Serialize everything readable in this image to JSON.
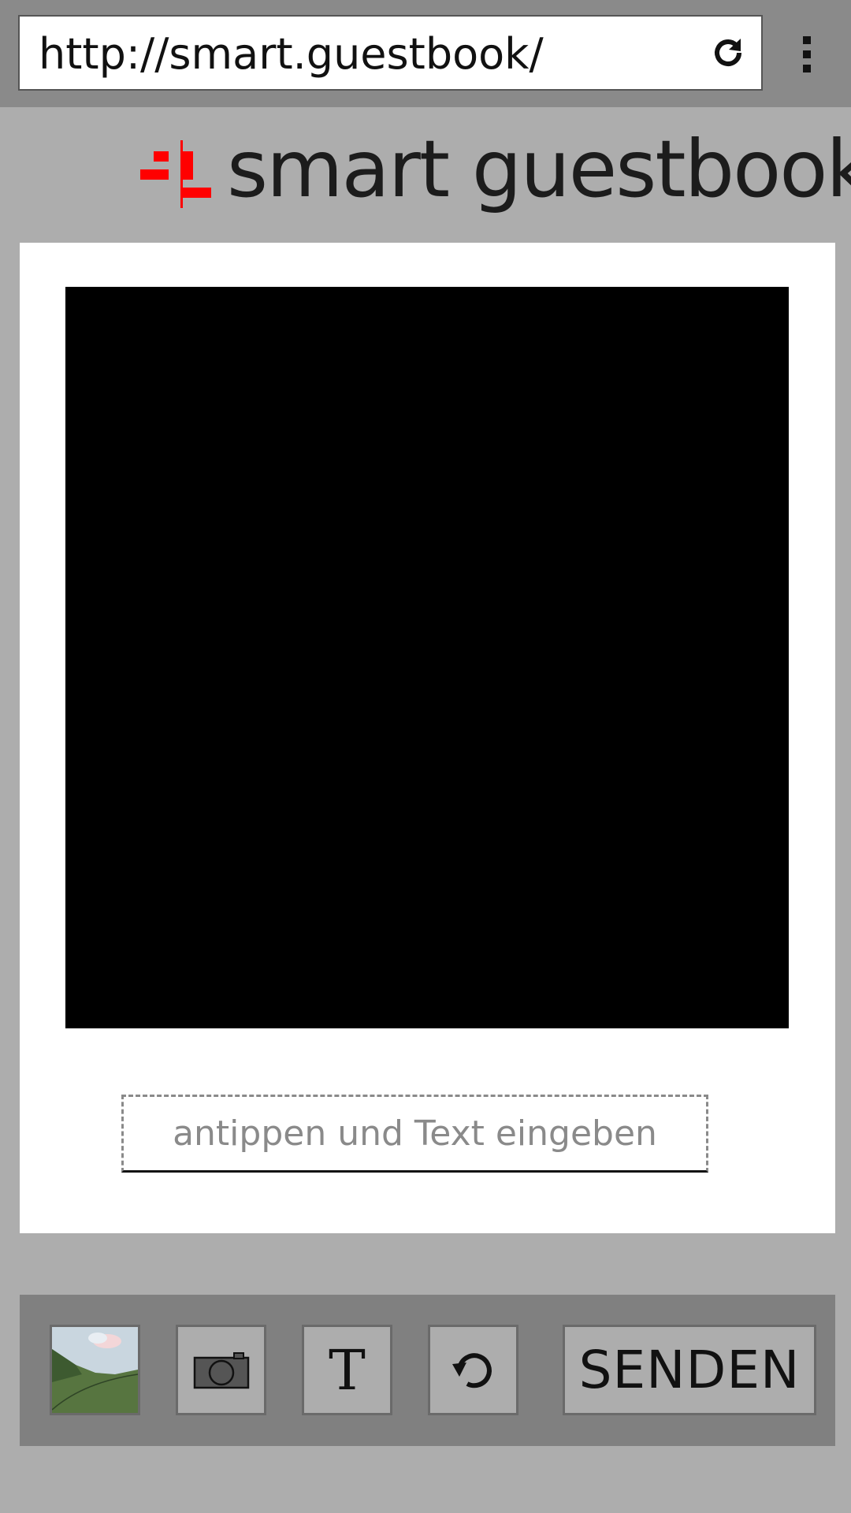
{
  "browser": {
    "url": "http://smart.guestbook/"
  },
  "header": {
    "logo_text": "smart guestbook",
    "brand_color": "#ff0000"
  },
  "card": {
    "text_placeholder": "antippen und Text eingeben"
  },
  "toolbar": {
    "gallery_icon": "gallery-image-icon",
    "camera_icon": "camera-icon",
    "text_label": "T",
    "undo_icon": "undo-icon",
    "send_label": "SENDEN"
  }
}
